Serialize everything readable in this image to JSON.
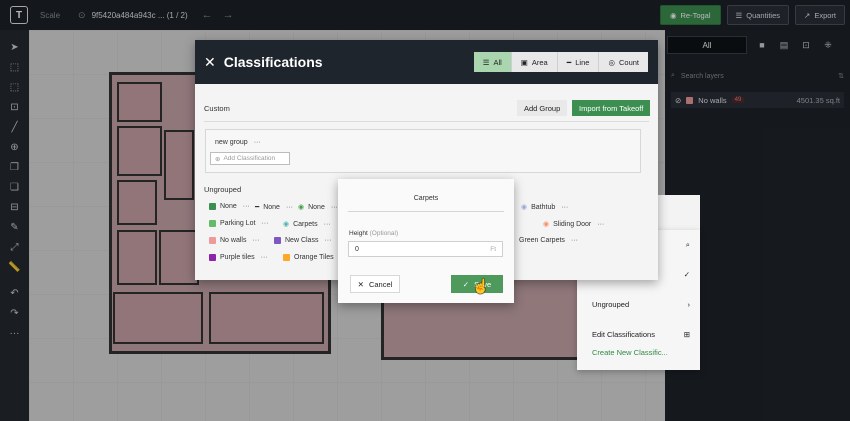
{
  "topbar": {
    "logo": "T",
    "scale_label": "Scale",
    "file_name": "9f5420a484a943c ... (1 / 2)",
    "retogal_label": "Re-Togal",
    "quantities_label": "Quantities",
    "export_label": "Export"
  },
  "left_tools": [
    "pointer-icon",
    "select-area-icon",
    "crop-icon",
    "polygon-icon",
    "line-icon",
    "count-icon",
    "copy-icon",
    "duplicate-icon",
    "cut-icon",
    "edit-icon",
    "measure-icon",
    "ruler-icon",
    "undo-icon",
    "redo-icon",
    "more-icon"
  ],
  "right_panel": {
    "tab_all": "All",
    "search_placeholder": "Search layers",
    "layer": {
      "name": "No walls",
      "badge": "49",
      "area": "4501.35 sq.ft"
    }
  },
  "modal": {
    "title": "Classifications",
    "seg": [
      "All",
      "Area",
      "Line",
      "Count"
    ],
    "custom_label": "Custom",
    "add_group": "Add Group",
    "import_takeoff": "Import from Takeoff",
    "group_name": "new group",
    "group_menu": "···",
    "add_classification": "Add Classification",
    "ungrouped_label": "Ungrouped",
    "chips": [
      {
        "label": "None",
        "color": "#3c8f50"
      },
      {
        "label": "None",
        "color": "#2e7d32"
      },
      {
        "label": "None",
        "color": "#43a047"
      },
      {
        "label": "Parking Lot",
        "color": "#66bb6a"
      },
      {
        "label": "Carpets",
        "color": "#4db6ac"
      },
      {
        "label": "No walls",
        "color": "#ef9a9a"
      },
      {
        "label": "New Class",
        "color": "#7e57c2"
      },
      {
        "label": "Purple tiles",
        "color": "#8e24aa"
      },
      {
        "label": "Orange Tiles",
        "color": "#ffa726"
      },
      {
        "label": "Bathtub",
        "color": "#9fa8da"
      },
      {
        "label": "Sliding Door",
        "color": "#ff8a65"
      },
      {
        "label": "Green Carpets",
        "color": "#2e7d32"
      }
    ]
  },
  "dialog": {
    "title": "Carpets",
    "height_label": "Height",
    "optional": "(Optional)",
    "height_value": "0",
    "unit": "Ft",
    "cancel": "Cancel",
    "save": "Save"
  },
  "menu": {
    "ungrouped": "Ungrouped",
    "edit": "Edit Classifications",
    "create": "Create New Classific..."
  }
}
